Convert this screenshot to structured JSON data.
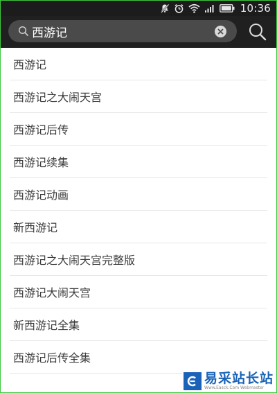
{
  "status_bar": {
    "time": "10:36",
    "icons": [
      "mute-icon",
      "alarm-icon",
      "wifi-icon",
      "signal-icon",
      "battery-icon"
    ]
  },
  "search": {
    "query": "西游记",
    "clear_icon": "clear-icon",
    "search_icon": "search-icon"
  },
  "suggestions": [
    "西游记",
    "西游记之大闹天宫",
    "西游记后传",
    "西游记续集",
    "西游记动画",
    "新西游记",
    "西游记之大闹天宫完整版",
    "西游记大闹天宫",
    "新西游记全集",
    "西游记后传全集"
  ],
  "watermark": {
    "name": "易采站长站",
    "url": "Www.Easck.Com Webmaster"
  },
  "colors": {
    "status_bar_bg": "#1c1c1c",
    "search_bar_bg": "#202020",
    "search_field_bg": "#4a4a4a",
    "frame_border": "#3ec83e",
    "watermark_blue": "#1a63b8"
  }
}
